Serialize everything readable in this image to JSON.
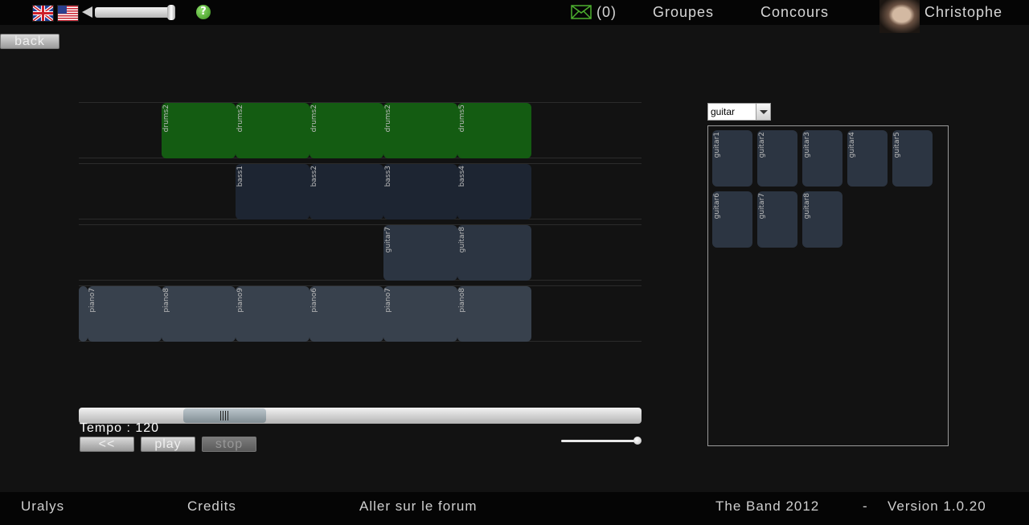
{
  "header": {
    "messages_count": "(0)",
    "nav_groups": "Groupes",
    "nav_contests": "Concours",
    "user_name": "Christophe",
    "help_glyph": "?"
  },
  "icons": {
    "flag_uk": "uk-flag-icon",
    "flag_us": "us-flag-icon",
    "volume": "speaker-icon",
    "help": "help-icon",
    "mail": "envelope-icon"
  },
  "controls": {
    "back_label": "back",
    "rewind_label": "<<",
    "play_label": "play",
    "stop_label": "stop",
    "tempo_text": "Tempo : 120"
  },
  "timeline": {
    "tracks": [
      {
        "color": "#145c12",
        "clips": [
          "drums2",
          "drums2",
          "drums2",
          "drums2",
          "drums5"
        ]
      },
      {
        "color": "#1d2532",
        "clips": [
          "bass1",
          "bass2",
          "bass3",
          "bass4"
        ]
      },
      {
        "color": "#2c3542",
        "clips": [
          "guitar7",
          "guitar8"
        ]
      },
      {
        "color": "#38414d",
        "clips": [
          "piano7",
          "piano8",
          "piano9",
          "piano6",
          "piano7",
          "piano8"
        ]
      }
    ]
  },
  "library": {
    "selected_instrument": "guitar",
    "clips": [
      "guitar1",
      "guitar2",
      "guitar3",
      "guitar4",
      "guitar5",
      "guitar6",
      "guitar7",
      "guitar8"
    ]
  },
  "footer": {
    "company": "Uralys",
    "credits": "Credits",
    "forum": "Aller sur le forum",
    "copyright": "The Band 2012",
    "separator": "-",
    "version": "Version 1.0.20"
  },
  "colors": {
    "accent_green": "#145c12",
    "background": "#121212",
    "bar": "#050505"
  }
}
